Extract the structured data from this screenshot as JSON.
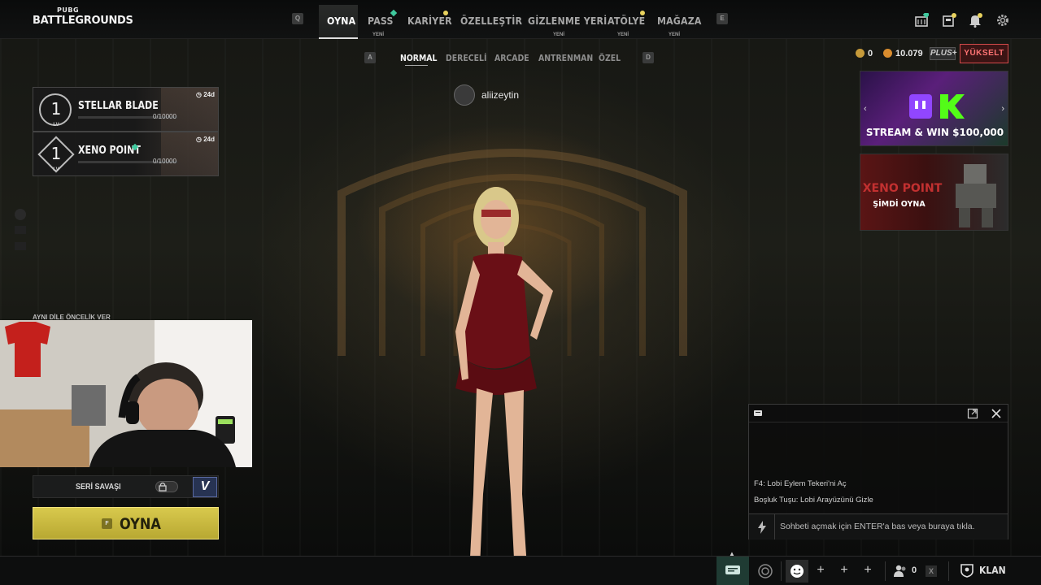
{
  "logo": {
    "small": "PUBG",
    "big": "BATTLEGROUNDS"
  },
  "nav": {
    "key_left": "Q",
    "key_right": "E",
    "items": [
      {
        "label": "OYNA",
        "badge": "",
        "active": true
      },
      {
        "label": "PASS",
        "badge": "YENİ"
      },
      {
        "label": "KARİYER",
        "badge": ""
      },
      {
        "label": "ÖZELLEŞTİR",
        "badge": ""
      },
      {
        "label": "GİZLENME YERİ",
        "badge": "YENİ"
      },
      {
        "label": "ATÖLYE",
        "badge": "YENİ"
      },
      {
        "label": "MAĞAZA",
        "badge": "YENİ"
      }
    ],
    "icons": [
      "storage-icon",
      "news-icon",
      "notification-bell-icon",
      "settings-gear-icon"
    ]
  },
  "modes": {
    "key_left": "A",
    "key_right": "D",
    "items": [
      "NORMAL",
      "DERECELİ",
      "ARCADE",
      "ANTRENMAN",
      "ÖZEL"
    ],
    "active": "NORMAL"
  },
  "currency": {
    "gcoin": "0",
    "bp": "10.079",
    "plus_label": "PLUS+",
    "upgrade_label": "YÜKSELT"
  },
  "player": {
    "name": "aliizeytin"
  },
  "passes": [
    {
      "level": "1",
      "lv": "LV",
      "title": "STELLAR BLADE",
      "progress": "0/10000",
      "time": "24d"
    },
    {
      "level": "1",
      "lv": "LV",
      "title": "XENO POINT",
      "progress": "0/10000",
      "time": "24d"
    }
  ],
  "left_panel": {
    "toggle_label": "AYNI DİLE ÖNCELİK VER",
    "streak_label": "SERİ SAVAŞI",
    "v_label": "V",
    "play_key": "F",
    "play_label": "OYNA"
  },
  "promos": [
    {
      "text": "STREAM & WIN $100,000"
    },
    {
      "title": "XENO POINT",
      "text": "ŞİMDİ OYNA"
    }
  ],
  "chat": {
    "lines": [
      "F4: Lobi Eylem Tekeri'ni Aç",
      "Boşluk Tuşu: Lobi Arayüzünü Gizle"
    ],
    "input_placeholder": "Sohbeti açmak için ENTER'a bas veya buraya tıkla."
  },
  "bottombar": {
    "friends_count": "0",
    "x_key": "X",
    "clan_label": "KLAN",
    "slots": [
      "+",
      "+",
      "+"
    ]
  },
  "colors": {
    "play_button": "#d8c94d",
    "upgrade_border": "#d24a4a",
    "new_dot": "#3fc99e",
    "chat_active": "#1f3b33"
  }
}
